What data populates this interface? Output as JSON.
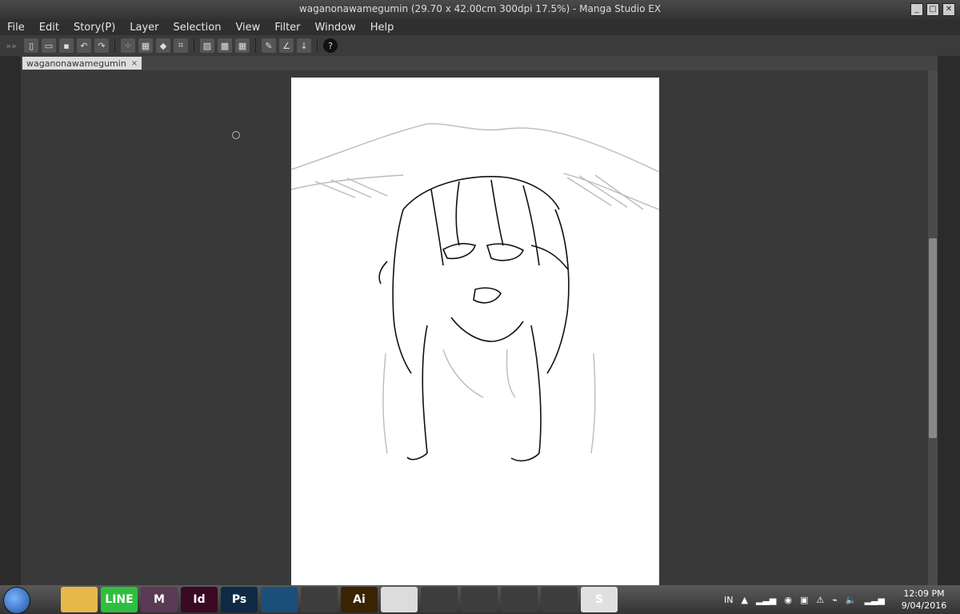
{
  "window": {
    "title": "waganonawamegumin (29.70 x 42.00cm 300dpi 17.5%)  - Manga Studio EX"
  },
  "menu": [
    "File",
    "Edit",
    "Story(P)",
    "Layer",
    "Selection",
    "View",
    "Filter",
    "Window",
    "Help"
  ],
  "toolbar": {
    "help_glyph": "?"
  },
  "tab": {
    "label": "waganonawamegumin",
    "close": "×"
  },
  "tray": {
    "lang": "IN"
  },
  "clock": {
    "time": "12:09 PM",
    "date": "9/04/2016"
  },
  "taskbar_icons": [
    {
      "name": "file-explorer-icon",
      "glyph": "",
      "color": "#e6b84a"
    },
    {
      "name": "line-app-icon",
      "glyph": "LINE",
      "color": "#2fbf3e"
    },
    {
      "name": "manga-studio-icon",
      "glyph": "M",
      "color": "#5a3a55"
    },
    {
      "name": "indesign-icon",
      "glyph": "Id",
      "color": "#3a0a22"
    },
    {
      "name": "photoshop-icon",
      "glyph": "Ps",
      "color": "#0e2a44"
    },
    {
      "name": "blue-app-icon",
      "glyph": "",
      "color": "#1b4f7a"
    },
    {
      "name": "shield-app-icon",
      "glyph": "",
      "color": "#3d3d3d"
    },
    {
      "name": "illustrator-icon",
      "glyph": "Ai",
      "color": "#3a2300"
    },
    {
      "name": "calendar-icon",
      "glyph": "",
      "color": "#dcdcdc"
    },
    {
      "name": "firefox-icon",
      "glyph": "",
      "color": "#3d3d3d"
    },
    {
      "name": "flag-app-icon",
      "glyph": "",
      "color": "#3d3d3d"
    },
    {
      "name": "chrome-icon",
      "glyph": "",
      "color": "#3d3d3d"
    },
    {
      "name": "vlc-icon",
      "glyph": "",
      "color": "#3d3d3d"
    },
    {
      "name": "skype-icon",
      "glyph": "S",
      "color": "#e0e0e0"
    }
  ]
}
